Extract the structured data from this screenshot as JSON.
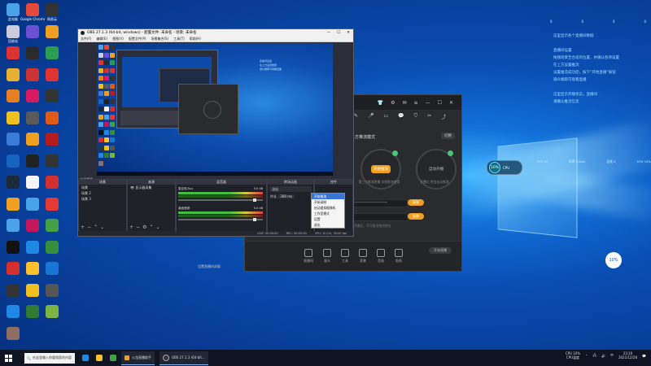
{
  "desktop": {
    "icons": [
      {
        "label": "此电脑",
        "color": "#4aa3e8"
      },
      {
        "label": "Google Chrome",
        "color": "#e34a3a"
      },
      {
        "label": "网易云",
        "color": "#333"
      },
      {
        "label": "回收站",
        "color": "#ccd"
      },
      {
        "label": "",
        "color": "#6b4fd6"
      },
      {
        "label": "",
        "color": "#f0a020"
      },
      {
        "label": "",
        "color": "#d33"
      },
      {
        "label": "",
        "color": "#2a2a2a"
      },
      {
        "label": "",
        "color": "#2a9d50"
      },
      {
        "label": "",
        "color": "#e8b030"
      },
      {
        "label": "",
        "color": "#c33"
      },
      {
        "label": "",
        "color": "#d33"
      },
      {
        "label": "",
        "color": "#e67e22"
      },
      {
        "label": "",
        "color": "#d81b60"
      },
      {
        "label": "",
        "color": "#333"
      },
      {
        "label": "",
        "color": "#f0c020"
      },
      {
        "label": "",
        "color": "#5a5a5a"
      },
      {
        "label": "",
        "color": "#e05a1a"
      },
      {
        "label": "",
        "color": "#3a7bd5"
      },
      {
        "label": "",
        "color": "#f0a020"
      },
      {
        "label": "",
        "color": "#b71c1c"
      },
      {
        "label": "",
        "color": "#1565c0"
      },
      {
        "label": "",
        "color": "#222"
      },
      {
        "label": "",
        "color": "#333"
      },
      {
        "label": "",
        "color": "#1b2838"
      },
      {
        "label": "",
        "color": "#f5f5f5"
      },
      {
        "label": "",
        "color": "#d32f2f"
      },
      {
        "label": "",
        "color": "#f0a020"
      },
      {
        "label": "",
        "color": "#4aa3e8"
      },
      {
        "label": "",
        "color": "#e53935"
      },
      {
        "label": "",
        "color": "#4aa3e8"
      },
      {
        "label": "",
        "color": "#c2185b"
      },
      {
        "label": "",
        "color": "#43a047"
      },
      {
        "label": "",
        "color": "#111"
      },
      {
        "label": "",
        "color": "#1e88e5"
      },
      {
        "label": "",
        "color": "#388e3c"
      },
      {
        "label": "",
        "color": "#d32f2f"
      },
      {
        "label": "",
        "color": "#fbc02d"
      },
      {
        "label": "",
        "color": "#1976d2"
      },
      {
        "label": "",
        "color": "#333"
      },
      {
        "label": "",
        "color": "#f0c020"
      },
      {
        "label": "",
        "color": "#555"
      },
      {
        "label": "",
        "color": "#1e88e5"
      },
      {
        "label": "",
        "color": "#2e7d32"
      },
      {
        "label": "",
        "color": "#7cb342"
      },
      {
        "label": "",
        "color": "#8d6e63"
      }
    ]
  },
  "right_panel": {
    "top_stats": [
      "0",
      "0",
      "0",
      "0"
    ],
    "lines": [
      "这里显示各个直播间数据",
      "",
      "直播间设置",
      "拖拽场景至合适的位置，并确认各项设置",
      "在上方设置推流",
      "设置推流成功后，按下“开始直播”按钮",
      "观众端即可观看直播",
      "",
      "这里显示开播状态，直播间",
      "请确认推流信息"
    ],
    "meter_value": "10%",
    "meter_label": "CPU",
    "meter2_value": "10%",
    "stats_row": [
      "FPS 30",
      "码率 0 kb/s",
      "丢帧 0",
      "CPU 10%"
    ]
  },
  "recorder_app": {
    "mode_label": "三方推流模式",
    "mode_button": "切换",
    "circle1_label": "开始推流",
    "circle1_cap": "第三方推流直播 仅限推流使用",
    "circle2_label": "自动开播",
    "circle2_cap": "开播后 将会自动推流",
    "field1": "*********************",
    "field2": "",
    "copy1": "复制",
    "copy2": "复制",
    "hint": "开播后，不可更改推流地址",
    "bottom_items": [
      "直播间",
      "观众",
      "工具",
      "背景",
      "音效",
      "贴纸"
    ],
    "save_label": "开始直播",
    "side_items": [
      "管理员",
      "任务",
      "设置"
    ],
    "footer_text": "设置直播间封面"
  },
  "obs": {
    "title": "OBS 27.1.3 (64-bit, windows) - 配置文件: 未命名 - 场景: 未命名",
    "menu": [
      "文件(F)",
      "编辑(E)",
      "视图(V)",
      "配置文件(P)",
      "场景集合(S)",
      "工具(T)",
      "帮助(H)"
    ],
    "dock_title": "未选择源",
    "panels": {
      "scenes": {
        "title": "场景",
        "items": [
          "场景",
          "场景 2",
          "场景 3"
        ]
      },
      "sources": {
        "title": "来源",
        "items": [
          "显示器采集"
        ]
      },
      "mixer": {
        "title": "混音器",
        "rows": [
          {
            "name": "麦克风/Aux",
            "db": "0.0 dB"
          },
          {
            "name": "桌面音频",
            "db": "0.0 dB"
          }
        ]
      },
      "transitions": {
        "title": "转场动画",
        "fade": "淡出",
        "duration_label": "时长",
        "duration": "300 ms"
      },
      "controls": {
        "title": "控件",
        "buttons": [
          "开始推流",
          "开始录制",
          "启动虚拟摄像机",
          "工作室模式",
          "设置",
          "退出"
        ]
      }
    },
    "context_menu": [
      "开始推流",
      "开始录制",
      "启动虚拟摄像机",
      "工作室模式",
      "设置",
      "退出"
    ],
    "context_selected": 0,
    "status": [
      "LIVE: 00:00:00",
      "REC: 00:00:00",
      "CPU: 10.1%, 30.00 fps"
    ]
  },
  "taskbar": {
    "search_placeholder": "在这里输入你要搜索的内容",
    "apps": [
      {
        "label": "火龙直播助手"
      },
      {
        "label": "OBS 27.1.3 (64-bit..."
      }
    ],
    "tray_cpu": "CPU 10%",
    "tray_label": "CPU温度",
    "time": "23:10",
    "date": "2021/12/28"
  }
}
